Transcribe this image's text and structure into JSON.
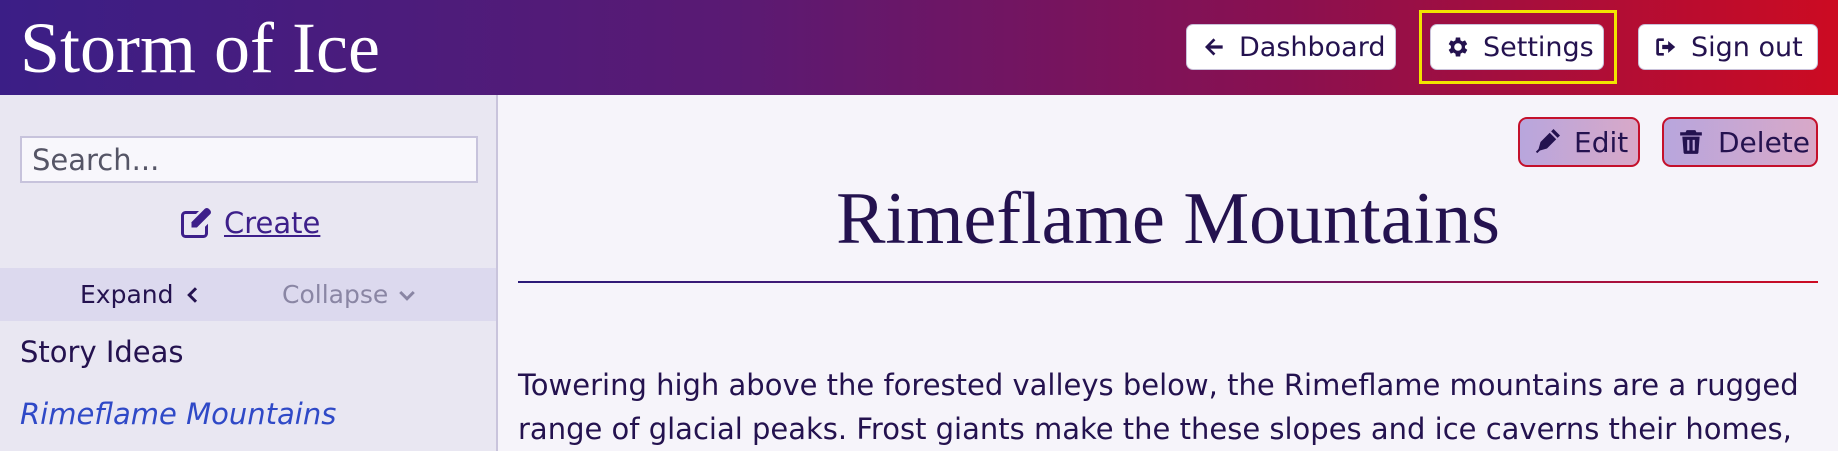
{
  "header": {
    "app_title": "Storm of Ice",
    "buttons": {
      "dashboard": "Dashboard",
      "settings": "Settings",
      "sign_out": "Sign out"
    },
    "focused_button": "settings",
    "focus_color": "#f2e300"
  },
  "sidebar": {
    "search_placeholder": "Search...",
    "create_label": "Create",
    "expand_label": "Expand",
    "collapse_label": "Collapse",
    "items": [
      {
        "label": "Story Ideas",
        "active": false
      },
      {
        "label": "Rimeflame Mountains",
        "active": true
      }
    ]
  },
  "main": {
    "actions": {
      "edit": "Edit",
      "delete": "Delete"
    },
    "title": "Rimeflame Mountains",
    "body": "Towering high above the forested valleys below, the Rimeflame mountains are a rugged range of glacial peaks. Frost giants make the these slopes and ice caverns their homes,"
  },
  "colors": {
    "header_start": "#3b1e86",
    "header_end": "#cc0b22",
    "link": "#2f49c7",
    "text": "#24124f"
  }
}
